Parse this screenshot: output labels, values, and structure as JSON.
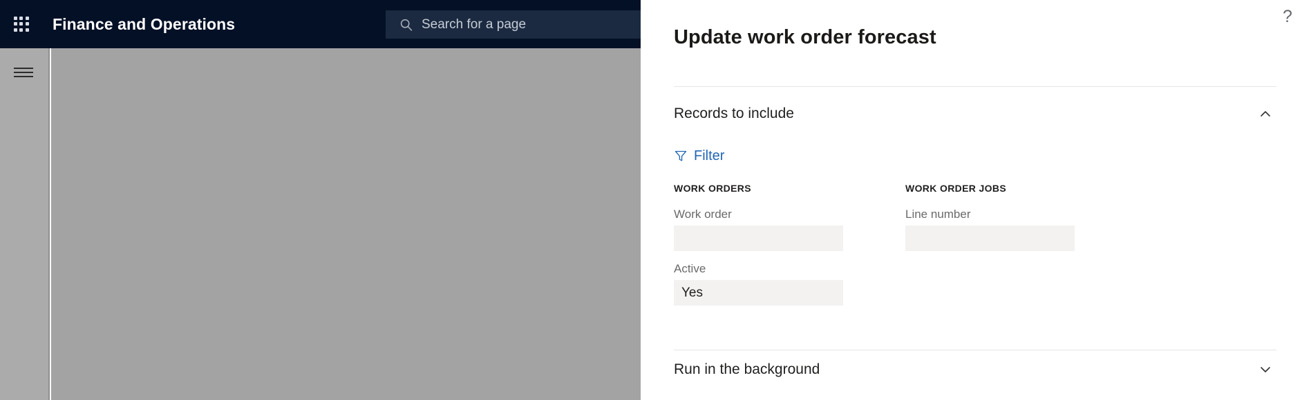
{
  "shell": {
    "app_title": "Finance and Operations",
    "waffle_icon": "app-launcher-grid-icon",
    "hamburger_icon": "hamburger-menu-icon",
    "search": {
      "placeholder": "Search for a page",
      "value": "",
      "icon": "search-icon"
    }
  },
  "panel": {
    "title": "Update work order forecast",
    "help_icon": "help-question-mark-icon",
    "sections": [
      {
        "id": "records-to-include",
        "title": "Records to include",
        "expanded": true,
        "chevron_icon": "chevron-up-icon"
      },
      {
        "id": "run-in-the-background",
        "title": "Run in the background",
        "expanded": false,
        "chevron_icon": "chevron-down-icon"
      }
    ],
    "filter": {
      "label": "Filter",
      "icon": "funnel-filter-icon"
    },
    "columns": [
      {
        "header": "WORK ORDERS",
        "fields": [
          {
            "label": "Work order",
            "value": "",
            "placeholder": ""
          },
          {
            "label": "Active",
            "value": "Yes",
            "placeholder": ""
          }
        ]
      },
      {
        "header": "WORK ORDER JOBS",
        "fields": [
          {
            "label": "Line number",
            "value": "",
            "placeholder": ""
          }
        ]
      }
    ]
  },
  "colors": {
    "header_navy": "#031026",
    "search_navy": "#1b2a40",
    "link_blue": "#2266b5",
    "workspace_grey": "#a3a3a3",
    "rail_grey": "#ababab",
    "input_grey": "#f3f2f1"
  }
}
